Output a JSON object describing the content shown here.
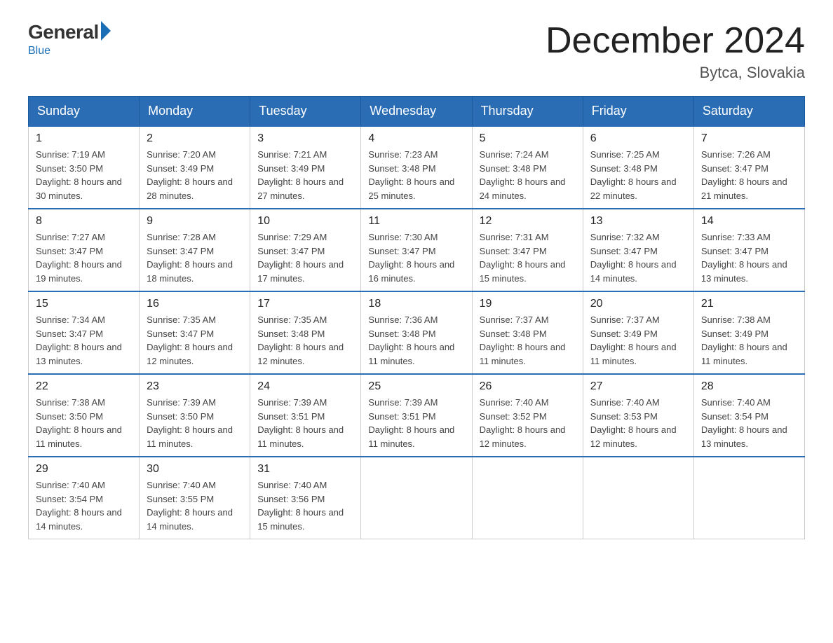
{
  "header": {
    "logo": {
      "general": "General",
      "blue": "Blue"
    },
    "title": "December 2024",
    "location": "Bytca, Slovakia"
  },
  "weekdays": [
    "Sunday",
    "Monday",
    "Tuesday",
    "Wednesday",
    "Thursday",
    "Friday",
    "Saturday"
  ],
  "weeks": [
    [
      {
        "day": "1",
        "sunrise": "7:19 AM",
        "sunset": "3:50 PM",
        "daylight": "8 hours and 30 minutes."
      },
      {
        "day": "2",
        "sunrise": "7:20 AM",
        "sunset": "3:49 PM",
        "daylight": "8 hours and 28 minutes."
      },
      {
        "day": "3",
        "sunrise": "7:21 AM",
        "sunset": "3:49 PM",
        "daylight": "8 hours and 27 minutes."
      },
      {
        "day": "4",
        "sunrise": "7:23 AM",
        "sunset": "3:48 PM",
        "daylight": "8 hours and 25 minutes."
      },
      {
        "day": "5",
        "sunrise": "7:24 AM",
        "sunset": "3:48 PM",
        "daylight": "8 hours and 24 minutes."
      },
      {
        "day": "6",
        "sunrise": "7:25 AM",
        "sunset": "3:48 PM",
        "daylight": "8 hours and 22 minutes."
      },
      {
        "day": "7",
        "sunrise": "7:26 AM",
        "sunset": "3:47 PM",
        "daylight": "8 hours and 21 minutes."
      }
    ],
    [
      {
        "day": "8",
        "sunrise": "7:27 AM",
        "sunset": "3:47 PM",
        "daylight": "8 hours and 19 minutes."
      },
      {
        "day": "9",
        "sunrise": "7:28 AM",
        "sunset": "3:47 PM",
        "daylight": "8 hours and 18 minutes."
      },
      {
        "day": "10",
        "sunrise": "7:29 AM",
        "sunset": "3:47 PM",
        "daylight": "8 hours and 17 minutes."
      },
      {
        "day": "11",
        "sunrise": "7:30 AM",
        "sunset": "3:47 PM",
        "daylight": "8 hours and 16 minutes."
      },
      {
        "day": "12",
        "sunrise": "7:31 AM",
        "sunset": "3:47 PM",
        "daylight": "8 hours and 15 minutes."
      },
      {
        "day": "13",
        "sunrise": "7:32 AM",
        "sunset": "3:47 PM",
        "daylight": "8 hours and 14 minutes."
      },
      {
        "day": "14",
        "sunrise": "7:33 AM",
        "sunset": "3:47 PM",
        "daylight": "8 hours and 13 minutes."
      }
    ],
    [
      {
        "day": "15",
        "sunrise": "7:34 AM",
        "sunset": "3:47 PM",
        "daylight": "8 hours and 13 minutes."
      },
      {
        "day": "16",
        "sunrise": "7:35 AM",
        "sunset": "3:47 PM",
        "daylight": "8 hours and 12 minutes."
      },
      {
        "day": "17",
        "sunrise": "7:35 AM",
        "sunset": "3:48 PM",
        "daylight": "8 hours and 12 minutes."
      },
      {
        "day": "18",
        "sunrise": "7:36 AM",
        "sunset": "3:48 PM",
        "daylight": "8 hours and 11 minutes."
      },
      {
        "day": "19",
        "sunrise": "7:37 AM",
        "sunset": "3:48 PM",
        "daylight": "8 hours and 11 minutes."
      },
      {
        "day": "20",
        "sunrise": "7:37 AM",
        "sunset": "3:49 PM",
        "daylight": "8 hours and 11 minutes."
      },
      {
        "day": "21",
        "sunrise": "7:38 AM",
        "sunset": "3:49 PM",
        "daylight": "8 hours and 11 minutes."
      }
    ],
    [
      {
        "day": "22",
        "sunrise": "7:38 AM",
        "sunset": "3:50 PM",
        "daylight": "8 hours and 11 minutes."
      },
      {
        "day": "23",
        "sunrise": "7:39 AM",
        "sunset": "3:50 PM",
        "daylight": "8 hours and 11 minutes."
      },
      {
        "day": "24",
        "sunrise": "7:39 AM",
        "sunset": "3:51 PM",
        "daylight": "8 hours and 11 minutes."
      },
      {
        "day": "25",
        "sunrise": "7:39 AM",
        "sunset": "3:51 PM",
        "daylight": "8 hours and 11 minutes."
      },
      {
        "day": "26",
        "sunrise": "7:40 AM",
        "sunset": "3:52 PM",
        "daylight": "8 hours and 12 minutes."
      },
      {
        "day": "27",
        "sunrise": "7:40 AM",
        "sunset": "3:53 PM",
        "daylight": "8 hours and 12 minutes."
      },
      {
        "day": "28",
        "sunrise": "7:40 AM",
        "sunset": "3:54 PM",
        "daylight": "8 hours and 13 minutes."
      }
    ],
    [
      {
        "day": "29",
        "sunrise": "7:40 AM",
        "sunset": "3:54 PM",
        "daylight": "8 hours and 14 minutes."
      },
      {
        "day": "30",
        "sunrise": "7:40 AM",
        "sunset": "3:55 PM",
        "daylight": "8 hours and 14 minutes."
      },
      {
        "day": "31",
        "sunrise": "7:40 AM",
        "sunset": "3:56 PM",
        "daylight": "8 hours and 15 minutes."
      },
      null,
      null,
      null,
      null
    ]
  ]
}
